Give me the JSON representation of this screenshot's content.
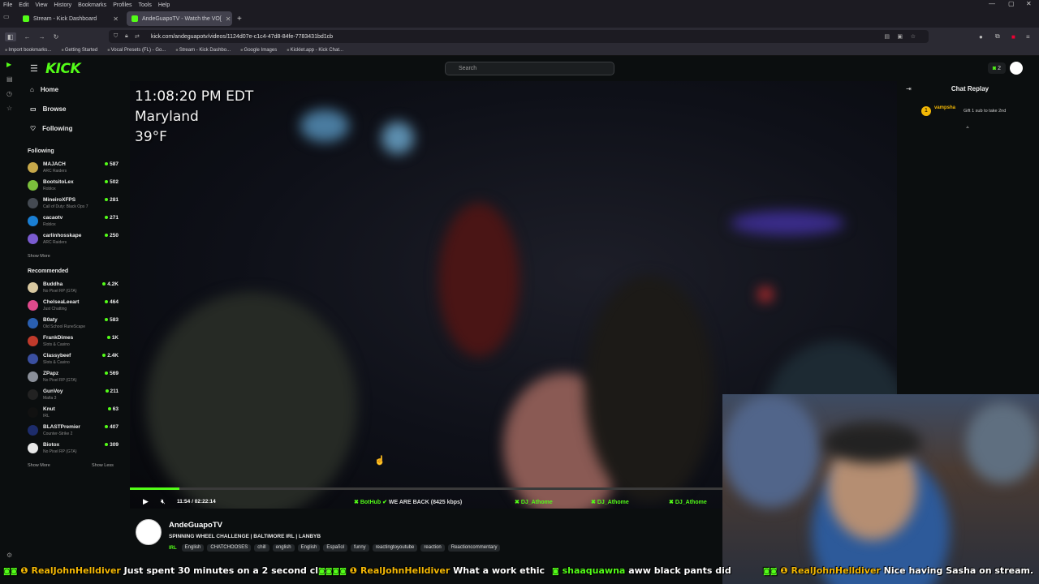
{
  "browser": {
    "menu": [
      "File",
      "Edit",
      "View",
      "History",
      "Bookmarks",
      "Profiles",
      "Tools",
      "Help"
    ],
    "tabs": [
      {
        "label": "Stream - Kick Dashboard",
        "active": false
      },
      {
        "label": "AndeGuapoTV - Watch the VO[",
        "active": true
      }
    ],
    "url": "kick.com/andeguapotv/videos/1124d07e-c1c4-47d8-84fe-7783431bd1cb",
    "bookmarks": [
      "Import bookmarks...",
      "Getting Started",
      "Vocal Presets (FL) - Go...",
      "Stream - Kick Dashbo...",
      "Google Images",
      "Kicklet.app - Kick Chat..."
    ]
  },
  "header": {
    "logo": "KICK",
    "search_placeholder": "Search",
    "notification_count": "2"
  },
  "sidebar": {
    "nav": [
      {
        "label": "Home"
      },
      {
        "label": "Browse"
      },
      {
        "label": "Following"
      }
    ],
    "following_title": "Following",
    "following": [
      {
        "name": "MAJACH",
        "category": "ARC Raiders",
        "viewers": "587",
        "color": "#c7a84a"
      },
      {
        "name": "BootsitoLex",
        "category": "Roblox",
        "viewers": "502",
        "color": "#7bbf3c"
      },
      {
        "name": "MineiroXFPS",
        "category": "Call of Duty: Black Ops 7",
        "viewers": "281",
        "color": "#444a52"
      },
      {
        "name": "cacaotv",
        "category": "Roblox",
        "viewers": "271",
        "color": "#1a7fd4"
      },
      {
        "name": "carlinhosskape",
        "category": "ARC Raiders",
        "viewers": "250",
        "color": "#7a5bd0"
      }
    ],
    "show_more": "Show More",
    "recommended_title": "Recommended",
    "recommended": [
      {
        "name": "Buddha",
        "category": "No Pixel RP (GTA)",
        "viewers": "4.2K",
        "color": "#d8c8a0"
      },
      {
        "name": "ChelseaLeeart",
        "category": "Just Chatting",
        "viewers": "464",
        "color": "#e04a8c"
      },
      {
        "name": "B0aty",
        "category": "Old School RuneScape",
        "viewers": "583",
        "color": "#2a5fb0"
      },
      {
        "name": "FrankDimes",
        "category": "Slots & Casino",
        "viewers": "1K",
        "color": "#c03a2b"
      },
      {
        "name": "Classybeef",
        "category": "Slots & Casino",
        "viewers": "2.4K",
        "color": "#3a4fa0"
      },
      {
        "name": "ZPapz",
        "category": "No Pixel RP (GTA)",
        "viewers": "569",
        "color": "#8a8f99"
      },
      {
        "name": "GunVoy",
        "category": "Mafia 3",
        "viewers": "211",
        "color": "#222"
      },
      {
        "name": "Knut",
        "category": "IRL",
        "viewers": "63",
        "color": "#111"
      },
      {
        "name": "BLASTPremier",
        "category": "Counter-Strike 2",
        "viewers": "407",
        "color": "#1d2c6b"
      },
      {
        "name": "Biotox",
        "category": "No Pixel RP (GTA)",
        "viewers": "309",
        "color": "#e8e8e8"
      }
    ],
    "show_more_2": "Show More",
    "show_less": "Show Less"
  },
  "video": {
    "overlay": {
      "time": "11:08:20 PM EDT",
      "location": "Maryland",
      "temperature": "39°F"
    },
    "current_time": "11:54",
    "duration": "02:22:14",
    "progress": 0.084,
    "chat_overlay": [
      {
        "user": "BotHub",
        "message": "WE ARE BACK (8425 kbps)"
      },
      {
        "user": "DJ_Athome",
        "message": ""
      },
      {
        "user": "DJ_Athome",
        "message": ""
      },
      {
        "user": "DJ_Athome",
        "message": ""
      }
    ]
  },
  "chat": {
    "title": "Chat Replay",
    "entries": [
      {
        "user": "vampsha",
        "message": "Gift 1 sub to take 2nd"
      }
    ]
  },
  "stream_info": {
    "streamer": "AndeGuapoTV",
    "title": "SPINNING WHEEL CHALLENGE | BALTIMORE IRL | LANBYB",
    "category": "IRL",
    "tags": [
      "English",
      "CHATCHOOSES",
      "chill",
      "english",
      "English",
      "Español",
      "funny",
      "reactingtoyoutube",
      "reaction",
      "Reactioncommentary"
    ]
  },
  "ticker": [
    {
      "user": "RealJohnHelldiver",
      "message": "Just spent 30 minutes on a 2 second clip."
    },
    {
      "user": "RealJohnHelldiver",
      "message": "What a work ethic"
    },
    {
      "user": "shaaquawna",
      "message": "aww black pants did"
    },
    {
      "user": "RealJohnHelldiver",
      "message": "Nice having Sasha on stream."
    }
  ],
  "colors": {
    "accent": "#53fc18",
    "background": "#0b0e0f",
    "ticker_user": "#f2b705"
  }
}
